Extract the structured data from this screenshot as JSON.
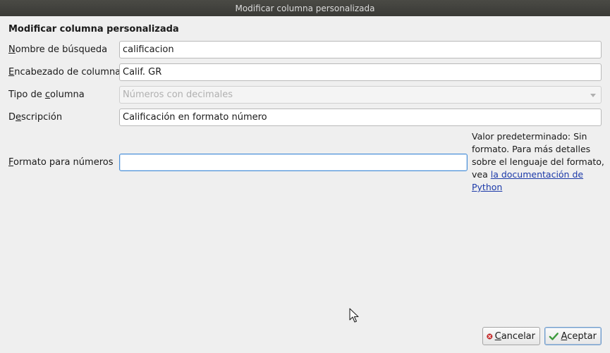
{
  "window": {
    "title": "Modificar columna personalizada"
  },
  "form": {
    "heading": "Modificar columna personalizada",
    "lookup_name": {
      "label_prefix": "",
      "label_mnemonic": "N",
      "label_rest": "ombre de búsqueda",
      "value": "calificacion"
    },
    "column_heading": {
      "label_prefix": "",
      "label_mnemonic": "E",
      "label_rest": "ncabezado de columna",
      "value": "Calif. GR"
    },
    "column_type": {
      "label_prefix": "Tipo de ",
      "label_mnemonic": "c",
      "label_rest": "olumna",
      "selected": "Números con decimales",
      "disabled": true
    },
    "description": {
      "label_prefix": "D",
      "label_mnemonic": "e",
      "label_rest": "scripción",
      "value": "Calificación en formato número"
    },
    "number_format": {
      "label_prefix": "",
      "label_mnemonic": "F",
      "label_rest": "ormato para números",
      "value": "",
      "help_text": "Valor predeterminado: Sin formato. Para más detalles sobre el lenguaje del formato, vea ",
      "help_link": "la documentación de Python"
    }
  },
  "buttons": {
    "cancel": {
      "mnemonic": "C",
      "rest": "ancelar"
    },
    "accept": {
      "mnemonic": "A",
      "rest": "ceptar"
    }
  },
  "colors": {
    "accent": "#4a90d9",
    "link": "#1c3aa9",
    "titlebar": "#3c3b37"
  },
  "icons": {
    "cancel": "cancel-circle-icon",
    "accept": "checkmark-icon",
    "combo": "chevron-down-icon",
    "cursor": "mouse-pointer-icon"
  }
}
